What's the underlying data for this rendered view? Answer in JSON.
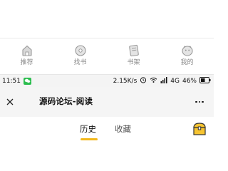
{
  "tabbar": {
    "items": [
      {
        "label": "推荐",
        "icon": "home-icon"
      },
      {
        "label": "找书",
        "icon": "compass-icon"
      },
      {
        "label": "书架",
        "icon": "book-icon"
      },
      {
        "label": "我的",
        "icon": "profile-icon"
      }
    ]
  },
  "status_bar": {
    "time": "11:51",
    "speed": "2.15K/s",
    "network": "4G",
    "battery": "46%"
  },
  "header": {
    "title": "源码论坛-阅读"
  },
  "reading_tabs": {
    "history": "历史",
    "favorites": "收藏"
  },
  "colors": {
    "accent": "#f2b81c",
    "statusbar_bg": "#f4f4f4",
    "header_bg": "#f5f5f5",
    "tab_label": "#8a8a8a"
  }
}
